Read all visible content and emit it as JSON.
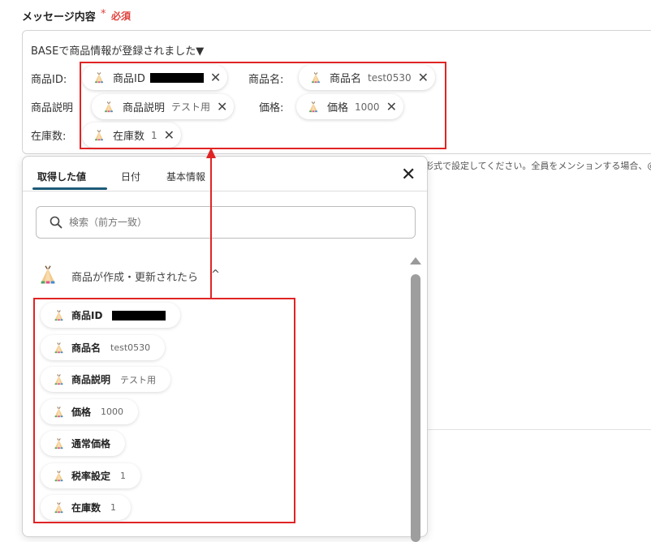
{
  "field": {
    "label": "メッセージ内容",
    "required_mark": "*",
    "required_text": "必須"
  },
  "editor": {
    "line1": "BASEで商品情報が登録されました▼",
    "row1_label1": "商品ID:",
    "row1_label2": "商品名:",
    "row2_label1": "商品説明",
    "row2_label2": "価格:",
    "row3_label1": "在庫数:",
    "tokens": [
      {
        "label": "商品ID",
        "value": "",
        "redacted": true
      },
      {
        "label": "商品名",
        "value": "test0530"
      },
      {
        "label": "商品説明",
        "value": "テスト用"
      },
      {
        "label": "価格",
        "value": "1000"
      },
      {
        "label": "在庫数",
        "value": "1"
      }
    ],
    "close_glyph": "✕"
  },
  "hint": "形式で設定してください。全員をメンションする場合、@ev",
  "popover": {
    "tabs": [
      {
        "label": "取得した値"
      },
      {
        "label": "日付"
      },
      {
        "label": "基本情報"
      }
    ],
    "close_glyph": "✕",
    "search_placeholder": "検索（前方一致）",
    "section_title": "商品が作成・更新されたら",
    "section_chevron": "^",
    "items": [
      {
        "label": "商品ID",
        "value": "",
        "redacted": true
      },
      {
        "label": "商品名",
        "value": "test0530"
      },
      {
        "label": "商品説明",
        "value": "テスト用"
      },
      {
        "label": "価格",
        "value": "1000"
      },
      {
        "label": "通常価格",
        "value": ""
      },
      {
        "label": "税率設定",
        "value": "1"
      },
      {
        "label": "在庫数",
        "value": "1"
      }
    ]
  },
  "colors": {
    "accent_red": "#e02424",
    "tab_underline": "#1c5a77",
    "required": "#e0403c"
  },
  "icons": {
    "token_icon": "tent-icon",
    "search": "search-icon",
    "close": "close-icon",
    "chevron": "chevron-up-icon"
  }
}
